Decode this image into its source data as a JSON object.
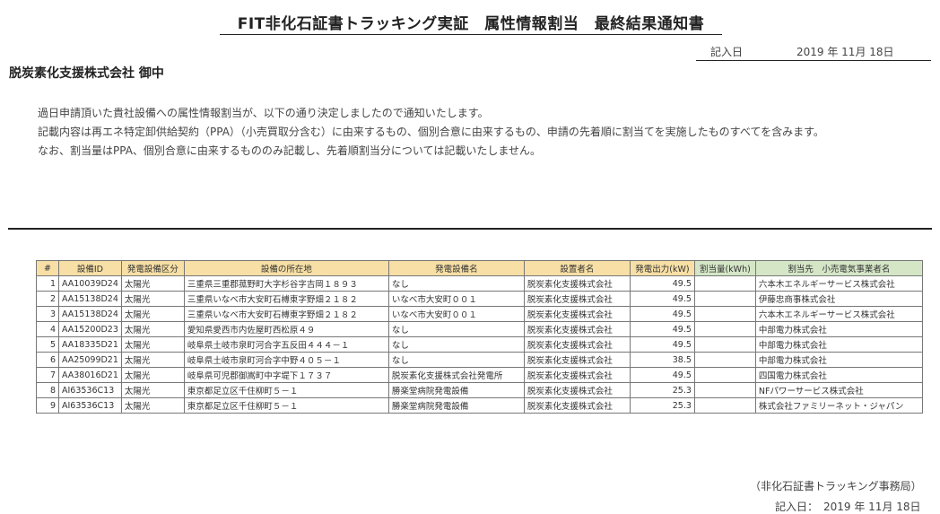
{
  "title": "FIT非化石証書トラッキング実証　属性情報割当　最終結果通知書",
  "date_top": {
    "label": "記入日",
    "value": "2019 年 11月 18日"
  },
  "recipient": "脱炭素化支援株式会社 御中",
  "body_lines": [
    "過日申請頂いた貴社設備への属性情報割当が、以下の通り決定しましたので通知いたします。",
    "記載内容は再エネ特定卸供給契約（PPA）（小売買取分含む）に由来するもの、個別合意に由来するもの、申請の先着順に割当てを実施したものすべてを含みます。",
    "なお、割当量はPPA、個別合意に由来するもののみ記載し、先着順割当分については記載いたしません。"
  ],
  "table": {
    "headers": [
      "#",
      "設備ID",
      "発電設備区分",
      "設備の所在地",
      "発電設備名",
      "設置者名",
      "発電出力(kW)",
      "割当量(kWh)",
      "割当先　小売電気事業者名"
    ],
    "rows": [
      [
        "1",
        "AA10039D24",
        "太陽光",
        "三重県三重郡菰野町大字杉谷字吉岡１８９３",
        "なし",
        "脱炭素化支援株式会社",
        "49.5",
        "",
        "六本木エネルギーサービス株式会社"
      ],
      [
        "2",
        "AA15138D24",
        "太陽光",
        "三重県いなべ市大安町石榑東字野畑２１８２",
        "いなべ市大安町００１",
        "脱炭素化支援株式会社",
        "49.5",
        "",
        "伊藤忠商事株式会社"
      ],
      [
        "3",
        "AA15138D24",
        "太陽光",
        "三重県いなべ市大安町石榑東字野畑２１８２",
        "いなべ市大安町００１",
        "脱炭素化支援株式会社",
        "49.5",
        "",
        "六本木エネルギーサービス株式会社"
      ],
      [
        "4",
        "AA15200D23",
        "太陽光",
        "愛知県愛西市内佐屋町西松原４９",
        "なし",
        "脱炭素化支援株式会社",
        "49.5",
        "",
        "中部電力株式会社"
      ],
      [
        "5",
        "AA18335D21",
        "太陽光",
        "岐阜県土岐市泉町河合字五反田４４４－１",
        "なし",
        "脱炭素化支援株式会社",
        "49.5",
        "",
        "中部電力株式会社"
      ],
      [
        "6",
        "AA25099D21",
        "太陽光",
        "岐阜県土岐市泉町河合字中野４０５－１",
        "なし",
        "脱炭素化支援株式会社",
        "38.5",
        "",
        "中部電力株式会社"
      ],
      [
        "7",
        "AA38016D21",
        "太陽光",
        "岐阜県可児郡御嵩町中字堤下１７３７",
        "脱炭素化支援株式会社発電所",
        "脱炭素化支援株式会社",
        "49.5",
        "",
        "四国電力株式会社"
      ],
      [
        "8",
        "AI63536C13",
        "太陽光",
        "東京都足立区千住柳町５－１",
        "勝楽堂病院発電設備",
        "脱炭素化支援株式会社",
        "25.3",
        "",
        "NFパワーサービス株式会社"
      ],
      [
        "9",
        "AI63536C13",
        "太陽光",
        "東京都足立区千住柳町５－１",
        "勝楽堂病院発電設備",
        "脱炭素化支援株式会社",
        "25.3",
        "",
        "株式会社ファミリーネット・ジャパン"
      ]
    ]
  },
  "sender": "（非化石証書トラッキング事務局）",
  "date_bottom": "記入日：　2019 年 11月 18日",
  "colors": {
    "header_tan": "#f7dfa5",
    "header_green": "#d4e6c6"
  }
}
